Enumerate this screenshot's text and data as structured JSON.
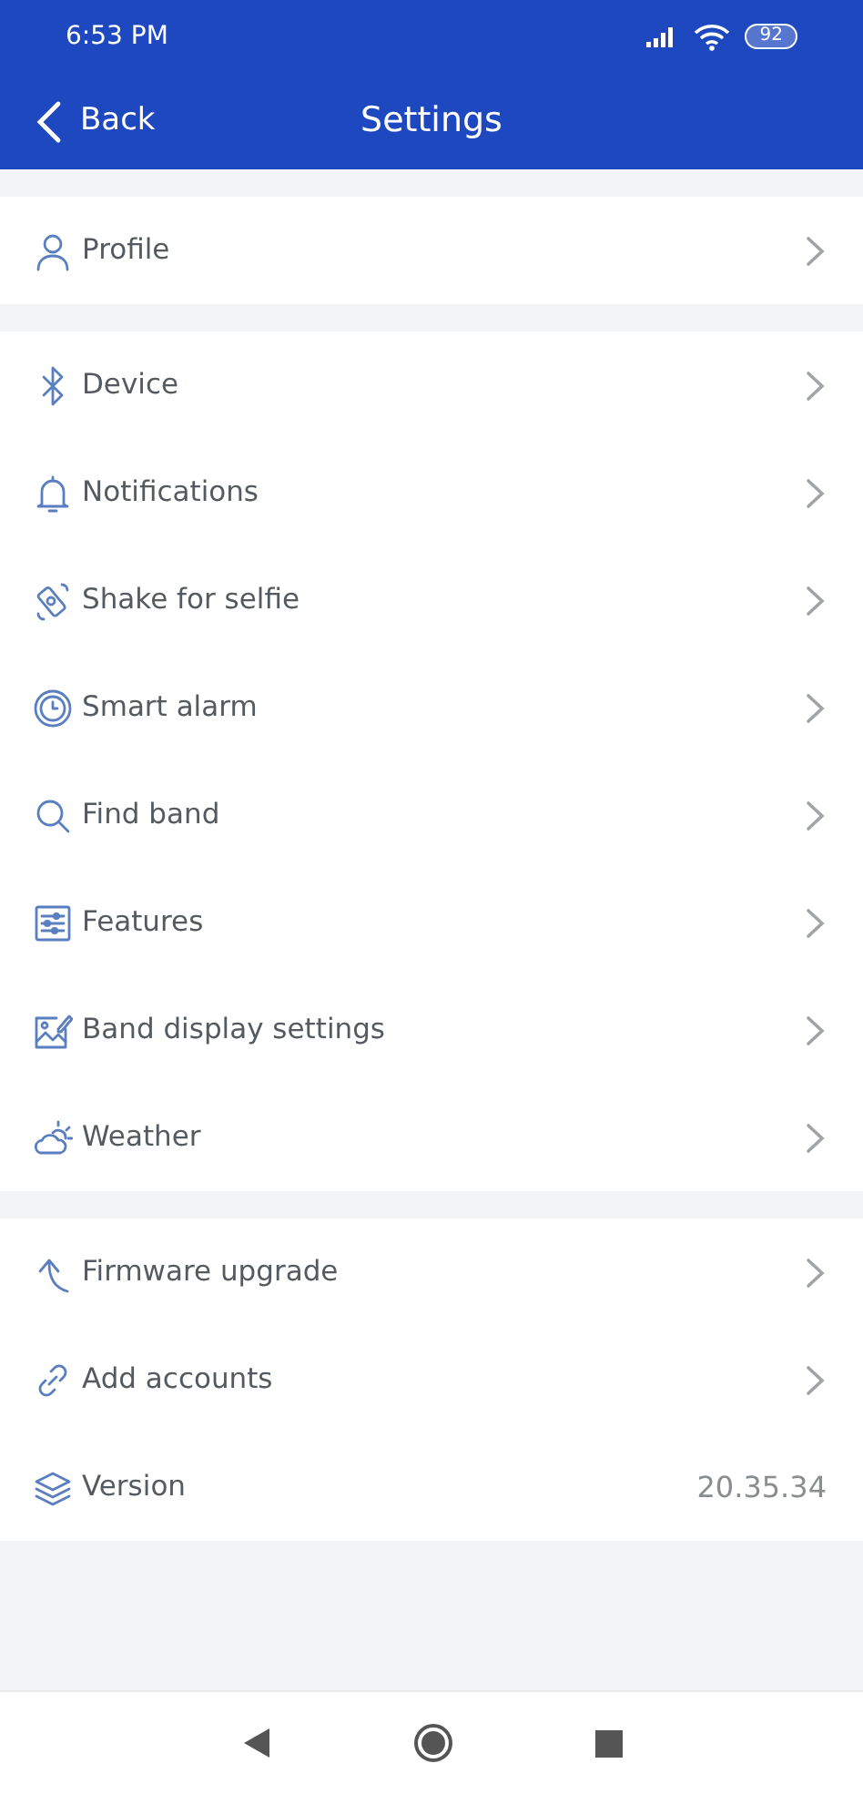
{
  "status_bar": {
    "time": "6:53 PM",
    "battery": "92"
  },
  "header": {
    "back": "Back",
    "title": "Settings"
  },
  "sections": [
    {
      "items": [
        {
          "label": "Profile",
          "kind": "link"
        }
      ]
    },
    {
      "items": [
        {
          "label": "Device",
          "kind": "link"
        },
        {
          "label": "Notifications",
          "kind": "link"
        },
        {
          "label": "Shake for selfie",
          "kind": "link"
        },
        {
          "label": "Smart alarm",
          "kind": "link"
        },
        {
          "label": "Find band",
          "kind": "link"
        },
        {
          "label": "Features",
          "kind": "link"
        },
        {
          "label": "Band display settings",
          "kind": "link"
        },
        {
          "label": "Weather",
          "kind": "link"
        }
      ]
    },
    {
      "items": [
        {
          "label": "Firmware upgrade",
          "kind": "link"
        },
        {
          "label": "Add accounts",
          "kind": "link"
        },
        {
          "label": "Version",
          "kind": "value",
          "value": "20.35.34"
        }
      ]
    }
  ]
}
